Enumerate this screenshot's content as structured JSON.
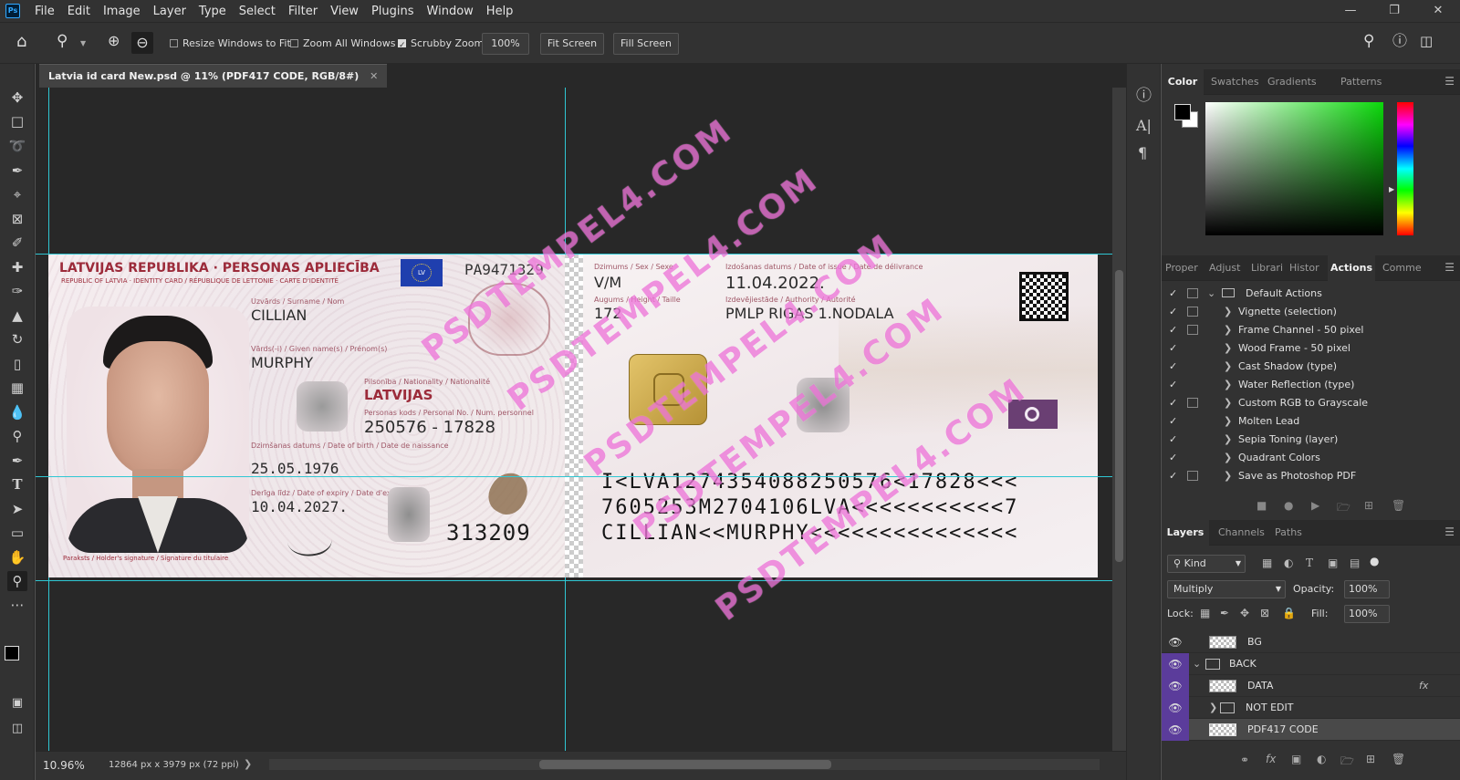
{
  "app": {
    "logo": "Ps",
    "menu": [
      "File",
      "Edit",
      "Image",
      "Layer",
      "Type",
      "Select",
      "Filter",
      "View",
      "Plugins",
      "Window",
      "Help"
    ]
  },
  "options": {
    "resize_windows": "Resize Windows to Fit",
    "zoom_all": "Zoom All Windows",
    "scrubby": "Scrubby Zoom",
    "zoom_value": "100%",
    "fit_screen": "Fit Screen",
    "fill_screen": "Fill Screen"
  },
  "document": {
    "tab_title": "Latvia id card New.psd @ 11% (PDF417 CODE, RGB/8#)",
    "zoom": "10.96%",
    "dimensions": "12864 px x 3979 px (72 ppi)"
  },
  "card": {
    "header_title": "LATVIJAS REPUBLIKA · PERSONAS APLIECĪBA",
    "header_sub": "REPUBLIC OF LATVIA · IDENTITY CARD / RÉPUBLIQUE DE LETTONIE · CARTE D'IDENTITÉ",
    "lv": "LV",
    "doc_number": "PA9471329",
    "surname_label": "Uzvārds / Surname / Nom",
    "surname": "CILLIAN",
    "given_label": "Vārds(-i) / Given name(s) / Prénom(s)",
    "given": "MURPHY",
    "nationality_label": "Pilsonība / Nationality / Nationalité",
    "nationality": "LATVIJAS",
    "personal_code_label": "Personas kods / Personal No. / Num. personnel",
    "personal_code": "250576 - 17828",
    "dob_label": "Dzimšanas datums / Date of birth / Date de naissance",
    "dob": "25.05.1976",
    "expiry_label": "Derīga līdz / Date of expiry / Date d'expiration",
    "expiry": "10.04.2027.",
    "can": "313209",
    "signature_label": "Paraksts / Holder's signature / Signature du titulaire",
    "sex_label": "Dzimums / Sex / Sexe",
    "sex": "V/M",
    "height_label": "Augums / Height / Taille",
    "height": "172",
    "issue_label": "Izdošanas datums / Date of issue / Date de délivrance",
    "issue": "11.04.2022.",
    "authority_label": "Izdevējiestāde / Authority / Autorité",
    "authority": "PMLP RIGAS 1.NODALA",
    "mrz1": "I<LVA1274354088250576<17828<<<",
    "mrz2": "7605253M2704106LVA<<<<<<<<<<<7",
    "mrz3": "CILLIAN<<MURPHY<<<<<<<<<<<<<<<",
    "watermark": "PSDTEMPEL4.COM"
  },
  "color_panel": {
    "tabs": [
      "Color",
      "Swatches",
      "Gradients",
      "Patterns"
    ]
  },
  "actions_panel": {
    "tabs": [
      "Proper",
      "Adjust",
      "Librari",
      "Histor",
      "Actions",
      "Comme"
    ],
    "set": "Default Actions",
    "items": [
      "Vignette (selection)",
      "Frame Channel - 50 pixel",
      "Wood Frame - 50 pixel",
      "Cast Shadow (type)",
      "Water Reflection (type)",
      "Custom RGB to Grayscale",
      "Molten Lead",
      "Sepia Toning (layer)",
      "Quadrant Colors",
      "Save as Photoshop PDF"
    ]
  },
  "layers_panel": {
    "tabs": [
      "Layers",
      "Channels",
      "Paths"
    ],
    "kind": "Kind",
    "blend": "Multiply",
    "opacity_label": "Opacity:",
    "opacity": "100%",
    "lock_label": "Lock:",
    "fill_label": "Fill:",
    "fill": "100%",
    "layers": [
      "BG",
      "BACK",
      "DATA",
      "NOT EDIT",
      "PDF417 CODE"
    ]
  },
  "colors": {
    "accent": "#31a8ff",
    "selected_layer": "#5b3c9b",
    "watermark": "#e63cc8",
    "card_red": "#9c2b3a"
  }
}
